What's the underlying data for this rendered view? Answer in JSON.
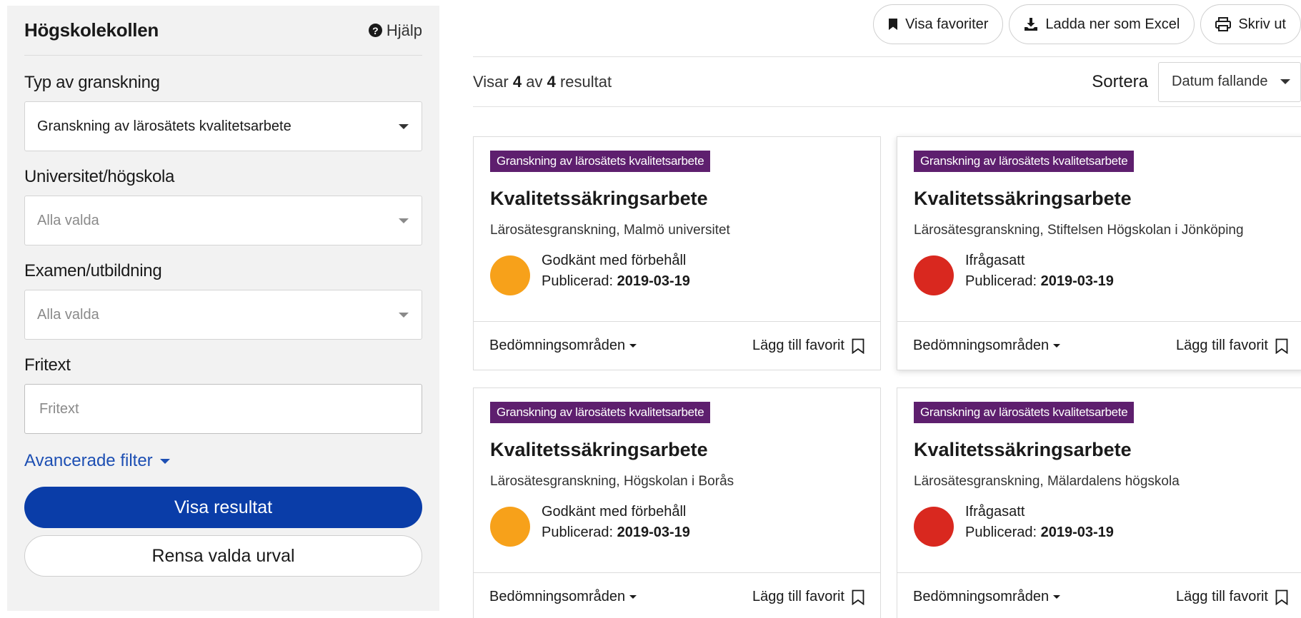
{
  "sidebar": {
    "title": "Högskolekollen",
    "help_label": "Hjälp",
    "filters": [
      {
        "label": "Typ av granskning",
        "value": "Granskning av lärosätets kvalitetsarbete"
      },
      {
        "label": "Universitet/högskola",
        "value": "Alla valda"
      },
      {
        "label": "Examen/utbildning",
        "value": "Alla valda"
      }
    ],
    "fritext": {
      "label": "Fritext",
      "placeholder": "Fritext"
    },
    "advanced_label": "Avancerade filter",
    "show_results_label": "Visa resultat",
    "clear_label": "Rensa valda urval"
  },
  "toolbar": {
    "favorites_label": "Visa favoriter",
    "excel_label": "Ladda ner som Excel",
    "print_label": "Skriv ut"
  },
  "results": {
    "prefix": "Visar",
    "shown": "4",
    "middle": "av",
    "total": "4",
    "suffix": "resultat"
  },
  "sort": {
    "label": "Sortera",
    "value": "Datum fallande"
  },
  "colors": {
    "approved_with_reservation": "#f7a11a",
    "questioned": "#d9281f",
    "tag_bg": "#5e1f6e",
    "primary": "#0a3da8"
  },
  "cards": [
    {
      "tag": "Granskning av lärosätets kvalitetsarbete",
      "title": "Kvalitetssäkringsarbete",
      "subtitle": "Lärosätesgranskning, Malmö universitet",
      "status": "Godkänt med förbehåll",
      "status_color": "#f7a11a",
      "published_label": "Publicerad:",
      "published_date": "2019-03-19",
      "areas_label": "Bedömningsområden",
      "favorite_label": "Lägg till favorit"
    },
    {
      "tag": "Granskning av lärosätets kvalitetsarbete",
      "title": "Kvalitetssäkringsarbete",
      "subtitle": "Lärosätesgranskning, Stiftelsen Högskolan i Jönköping",
      "status": "Ifrågasatt",
      "status_color": "#d9281f",
      "published_label": "Publicerad:",
      "published_date": "2019-03-19",
      "areas_label": "Bedömningsområden",
      "favorite_label": "Lägg till favorit"
    },
    {
      "tag": "Granskning av lärosätets kvalitetsarbete",
      "title": "Kvalitetssäkringsarbete",
      "subtitle": "Lärosätesgranskning, Högskolan i Borås",
      "status": "Godkänt med förbehåll",
      "status_color": "#f7a11a",
      "published_label": "Publicerad:",
      "published_date": "2019-03-19",
      "areas_label": "Bedömningsområden",
      "favorite_label": "Lägg till favorit"
    },
    {
      "tag": "Granskning av lärosätets kvalitetsarbete",
      "title": "Kvalitetssäkringsarbete",
      "subtitle": "Lärosätesgranskning, Mälardalens högskola",
      "status": "Ifrågasatt",
      "status_color": "#d9281f",
      "published_label": "Publicerad:",
      "published_date": "2019-03-19",
      "areas_label": "Bedömningsområden",
      "favorite_label": "Lägg till favorit"
    }
  ]
}
